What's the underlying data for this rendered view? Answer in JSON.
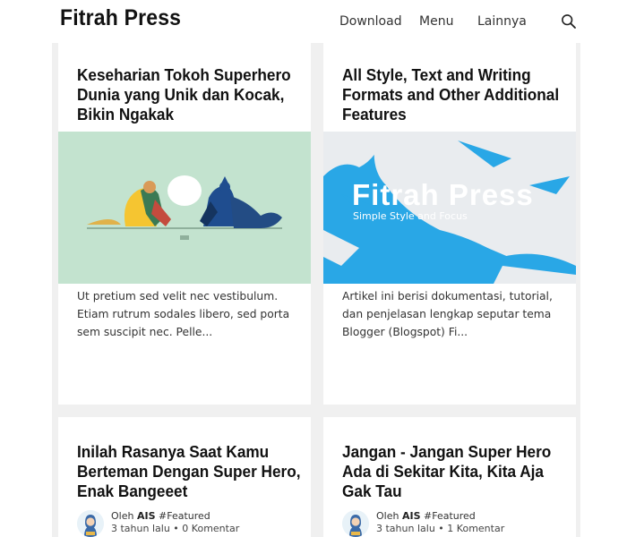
{
  "header": {
    "brand": "Fitrah Press",
    "nav": [
      "Download",
      "Menu",
      "Lainnya"
    ],
    "search_icon": "search-icon"
  },
  "posts": [
    {
      "title": "Keseharian Tokoh Superhero Dunia yang Unik dan Kocak, Bikin Ngakak",
      "excerpt": "Ut pretium sed velit nec vestibulum. Etiam rutrum sodales libero, sed porta sem suscipit nec. Pelle...",
      "image_bg": "#c3e3cf"
    },
    {
      "title": "All Style, Text and Writing Formats and Other Additional Features",
      "excerpt": "Artikel ini berisi dokumentasi, tutorial, dan penjelasan lengkap seputar tema Blogger (Blogspot) Fi...",
      "image_title": "Fitrah Press",
      "image_subtitle": "Simple Style and Focus",
      "image_bg": "#29a7e6"
    },
    {
      "title": "Inilah Rasanya Saat Kamu Berteman Dengan Super Hero, Enak Bangeeet",
      "meta_prefix": "Oleh",
      "author": "AIS",
      "label": "#Featured",
      "time": "3 tahun lalu",
      "comments": "0 Komentar"
    },
    {
      "title": "Jangan - Jangan Super Hero Ada di Sekitar Kita, Kita Aja Gak Tau",
      "meta_prefix": "Oleh",
      "author": "AIS",
      "label": "#Featured",
      "time": "3 tahun lalu",
      "comments": "1 Komentar"
    }
  ]
}
